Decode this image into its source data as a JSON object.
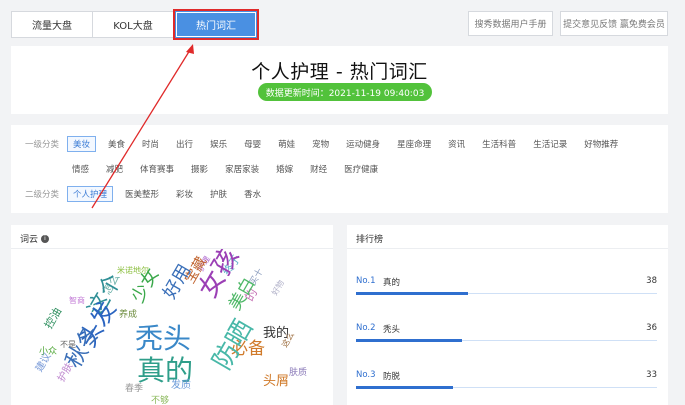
{
  "top_tabs": [
    {
      "label": "流量大盘"
    },
    {
      "label": "KOL大盘"
    },
    {
      "label": "热门词汇"
    }
  ],
  "top_buttons": {
    "manual": "搜秀数据用户手册",
    "feedback": "提交意见反馈 赢免费会员"
  },
  "hero": {
    "title": "个人护理 - 热门词汇",
    "updated": "数据更新时间：2021-11-19 09:40:03"
  },
  "filters": {
    "level1_label": "一级分类",
    "level1_row1": [
      "美妆",
      "美食",
      "时尚",
      "出行",
      "娱乐",
      "母婴",
      "萌娃",
      "宠物",
      "运动健身",
      "星座命理",
      "资讯",
      "生活科普",
      "生活记录",
      "好物推荐"
    ],
    "level1_row2": [
      "情感",
      "减肥",
      "体育赛事",
      "摄影",
      "家居家装",
      "婚嫁",
      "财经",
      "医疗健康"
    ],
    "level2_label": "二级分类",
    "level2": [
      "个人护理",
      "医美整形",
      "彩妆",
      "护肤",
      "香水"
    ]
  },
  "cloud_panel": {
    "title": "词云",
    "words": [
      "米诺地尔",
      "护理",
      "终于",
      "智商",
      "怎么",
      "少女",
      "宝藏",
      "好用",
      "女孩",
      "买十",
      "的",
      "这个",
      "美白",
      "好物",
      "养成",
      "我的",
      "控油",
      "头发",
      "秃头",
      "不是",
      "小众",
      "秋冬",
      "真的",
      "建议",
      "必备",
      "这么",
      "防晒",
      "护肤",
      "头屑",
      "肤质",
      "发质",
      "春季",
      "不够"
    ]
  },
  "rank_panel": {
    "title": "排行榜",
    "items": [
      {
        "no": "No.1",
        "word": "真的",
        "count": "38",
        "ratio": 1.0
      },
      {
        "no": "No.2",
        "word": "秃头",
        "count": "36",
        "ratio": 0.947
      },
      {
        "no": "No.3",
        "word": "防脱",
        "count": "33",
        "ratio": 0.868
      }
    ]
  },
  "colors": {
    "accent": "#4a90e2",
    "badge": "#52c23b",
    "annotation": "#e02a2a"
  }
}
